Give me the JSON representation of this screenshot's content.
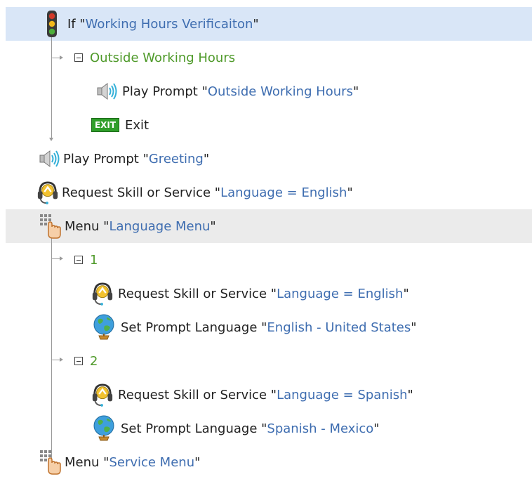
{
  "tree": {
    "if_node": {
      "keyword": "If",
      "value": "Working Hours Verificaiton"
    },
    "branch_outside": {
      "label": "Outside Working Hours"
    },
    "play_outside": {
      "keyword": "Play Prompt",
      "value": "Outside Working Hours"
    },
    "exit": {
      "badge": "EXIT",
      "label": "Exit"
    },
    "play_greeting": {
      "keyword": "Play Prompt",
      "value": "Greeting"
    },
    "request_english_top": {
      "keyword": "Request Skill or Service",
      "value": "Language = English"
    },
    "menu_language": {
      "keyword": "Menu",
      "value": "Language Menu"
    },
    "branch_1": {
      "label": "1"
    },
    "request_english": {
      "keyword": "Request Skill or Service",
      "value": "Language = English"
    },
    "set_lang_english": {
      "keyword": "Set Prompt Language",
      "value": "English - United States"
    },
    "branch_2": {
      "label": "2"
    },
    "request_spanish": {
      "keyword": "Request Skill or Service",
      "value": "Language = Spanish"
    },
    "set_lang_spanish": {
      "keyword": "Set Prompt Language",
      "value": "Spanish - Mexico"
    },
    "menu_service": {
      "keyword": "Menu",
      "value": "Service Menu"
    }
  },
  "icons": {
    "if_node": "traffic-light-icon",
    "play_prompt": "speaker-icon",
    "exit": "exit-sign-icon",
    "request_skill": "headset-icon",
    "menu": "keypad-hand-icon",
    "set_language": "globe-icon"
  },
  "colors": {
    "value_text": "#3e6db0",
    "group_text": "#4f9a2a",
    "selected_row": "#d9e6f7",
    "hover_row": "#ebebeb"
  }
}
